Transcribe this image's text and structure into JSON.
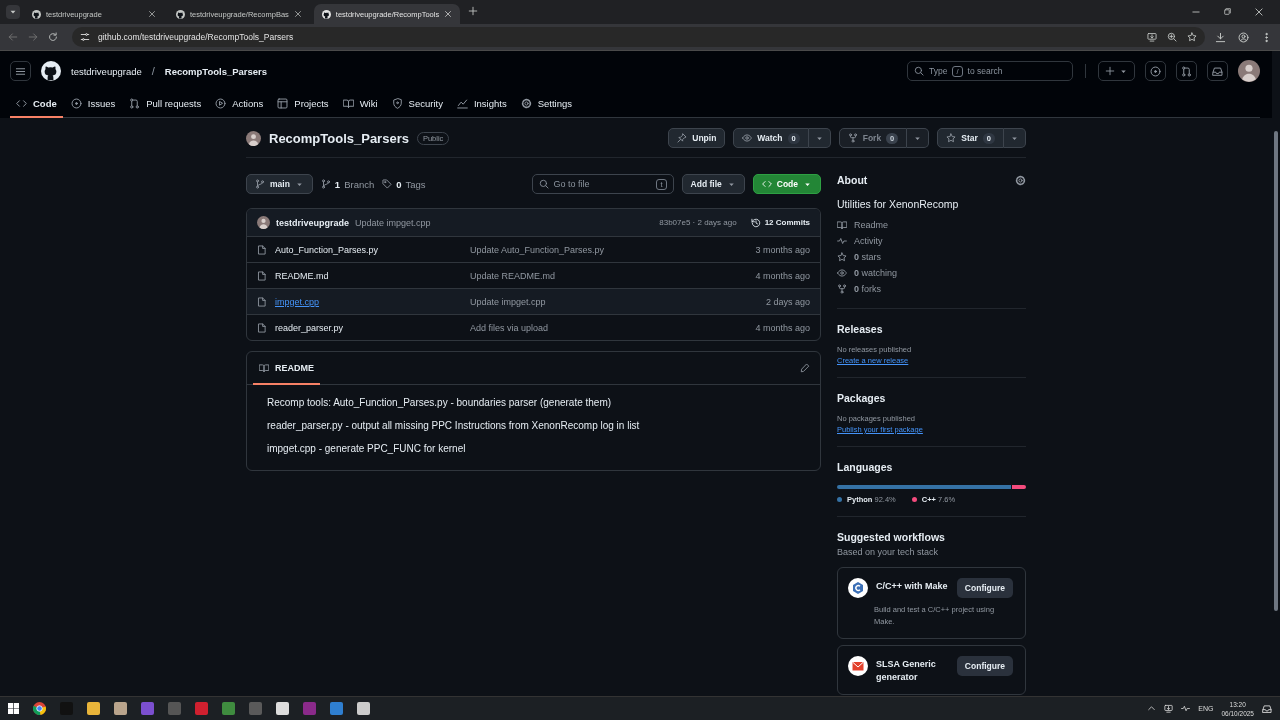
{
  "browser": {
    "tabs": [
      {
        "title": "testdriveupgrade",
        "selected": false
      },
      {
        "title": "testdriveupgrade/RecompBas",
        "selected": false
      },
      {
        "title": "testdriveupgrade/RecompTools",
        "selected": true
      }
    ],
    "url": "github.com/testdriveupgrade/RecompTools_Parsers"
  },
  "header": {
    "owner": "testdriveupgrade",
    "separator": "/",
    "repo": "RecompTools_Parsers",
    "search": {
      "before": "Type",
      "key": "/",
      "after": "to search"
    }
  },
  "repo_nav": [
    {
      "kind": "code",
      "label": "Code",
      "selected": true
    },
    {
      "kind": "issues",
      "label": "Issues",
      "selected": false
    },
    {
      "kind": "pulls",
      "label": "Pull requests",
      "selected": false
    },
    {
      "kind": "actions",
      "label": "Actions",
      "selected": false
    },
    {
      "kind": "projects",
      "label": "Projects",
      "selected": false
    },
    {
      "kind": "wiki",
      "label": "Wiki",
      "selected": false
    },
    {
      "kind": "security",
      "label": "Security",
      "selected": false
    },
    {
      "kind": "insights",
      "label": "Insights",
      "selected": false
    },
    {
      "kind": "settings",
      "label": "Settings",
      "selected": false
    }
  ],
  "repo": {
    "name": "RecompTools_Parsers",
    "visibility": "Public",
    "actions": [
      {
        "kind": "unpin",
        "label": "Unpin",
        "disabled": false
      },
      {
        "kind": "watch",
        "label": "Watch",
        "count": "0",
        "disabled": false
      },
      {
        "kind": "fork",
        "label": "Fork",
        "count": "0",
        "disabled": true
      },
      {
        "kind": "star",
        "label": "Star",
        "count": "0",
        "disabled": false
      }
    ]
  },
  "toolbar": {
    "branch": "main",
    "branches": {
      "count": "1",
      "label": "Branch"
    },
    "tags": {
      "count": "0",
      "label": "Tags"
    },
    "file_search": {
      "placeholder": "Go to file",
      "key": "t"
    },
    "add_file": "Add file",
    "code": "Code"
  },
  "latest_commit": {
    "author": "testdriveupgrade",
    "message": "Update impget.cpp",
    "hash_time": "83b07e5 · 2 days ago",
    "commits": "12 Commits"
  },
  "files": [
    {
      "name": "Auto_Function_Parses.py",
      "message": "Update Auto_Function_Parses.py",
      "time": "3 months ago",
      "hovered": false
    },
    {
      "name": "README.md",
      "message": "Update README.md",
      "time": "4 months ago",
      "hovered": false
    },
    {
      "name": "impget.cpp",
      "message": "Update impget.cpp",
      "time": "2 days ago",
      "hovered": true
    },
    {
      "name": "reader_parser.py",
      "message": "Add files via upload",
      "time": "4 months ago",
      "hovered": false
    }
  ],
  "readme": {
    "tab": "README",
    "paragraphs": [
      "Recomp tools: Auto_Function_Parses.py - boundaries parser (generate them)",
      "reader_parser.py - output all missing PPC Instructions from XenonRecomp log in list",
      "impget.cpp - generate PPC_FUNC for kernel"
    ]
  },
  "about": {
    "title": "About",
    "description": "Utilities for XenonRecomp",
    "links": [
      {
        "kind": "readme",
        "label": "Readme"
      },
      {
        "kind": "activity",
        "label": "Activity"
      },
      {
        "kind": "stars",
        "count": "0",
        "label": "stars"
      },
      {
        "kind": "watching",
        "count": "0",
        "label": "watching"
      },
      {
        "kind": "forks",
        "count": "0",
        "label": "forks"
      }
    ]
  },
  "releases": {
    "title": "Releases",
    "note": "No releases published",
    "link": "Create a new release"
  },
  "packages": {
    "title": "Packages",
    "note": "No packages published",
    "link": "Publish your first package"
  },
  "languages": {
    "title": "Languages",
    "items": [
      {
        "name": "Python",
        "percent": "92.4%",
        "color": "#3572a5",
        "level": 0.924
      },
      {
        "name": "C++",
        "percent": "7.6%",
        "color": "#f34b7d",
        "level": 0.076
      }
    ]
  },
  "workflows": {
    "title": "Suggested workflows",
    "subtitle": "Based on your tech stack",
    "items": [
      {
        "kind": "make",
        "title": "C/C++ with Make",
        "description": "Build and test a C/C++ project using Make.",
        "button": "Configure"
      },
      {
        "kind": "slsa",
        "title": "SLSA Generic generator",
        "button": "Configure"
      }
    ]
  },
  "taskbar": {
    "language": "ENG",
    "time": "13:20",
    "date": "06/10/2025"
  }
}
